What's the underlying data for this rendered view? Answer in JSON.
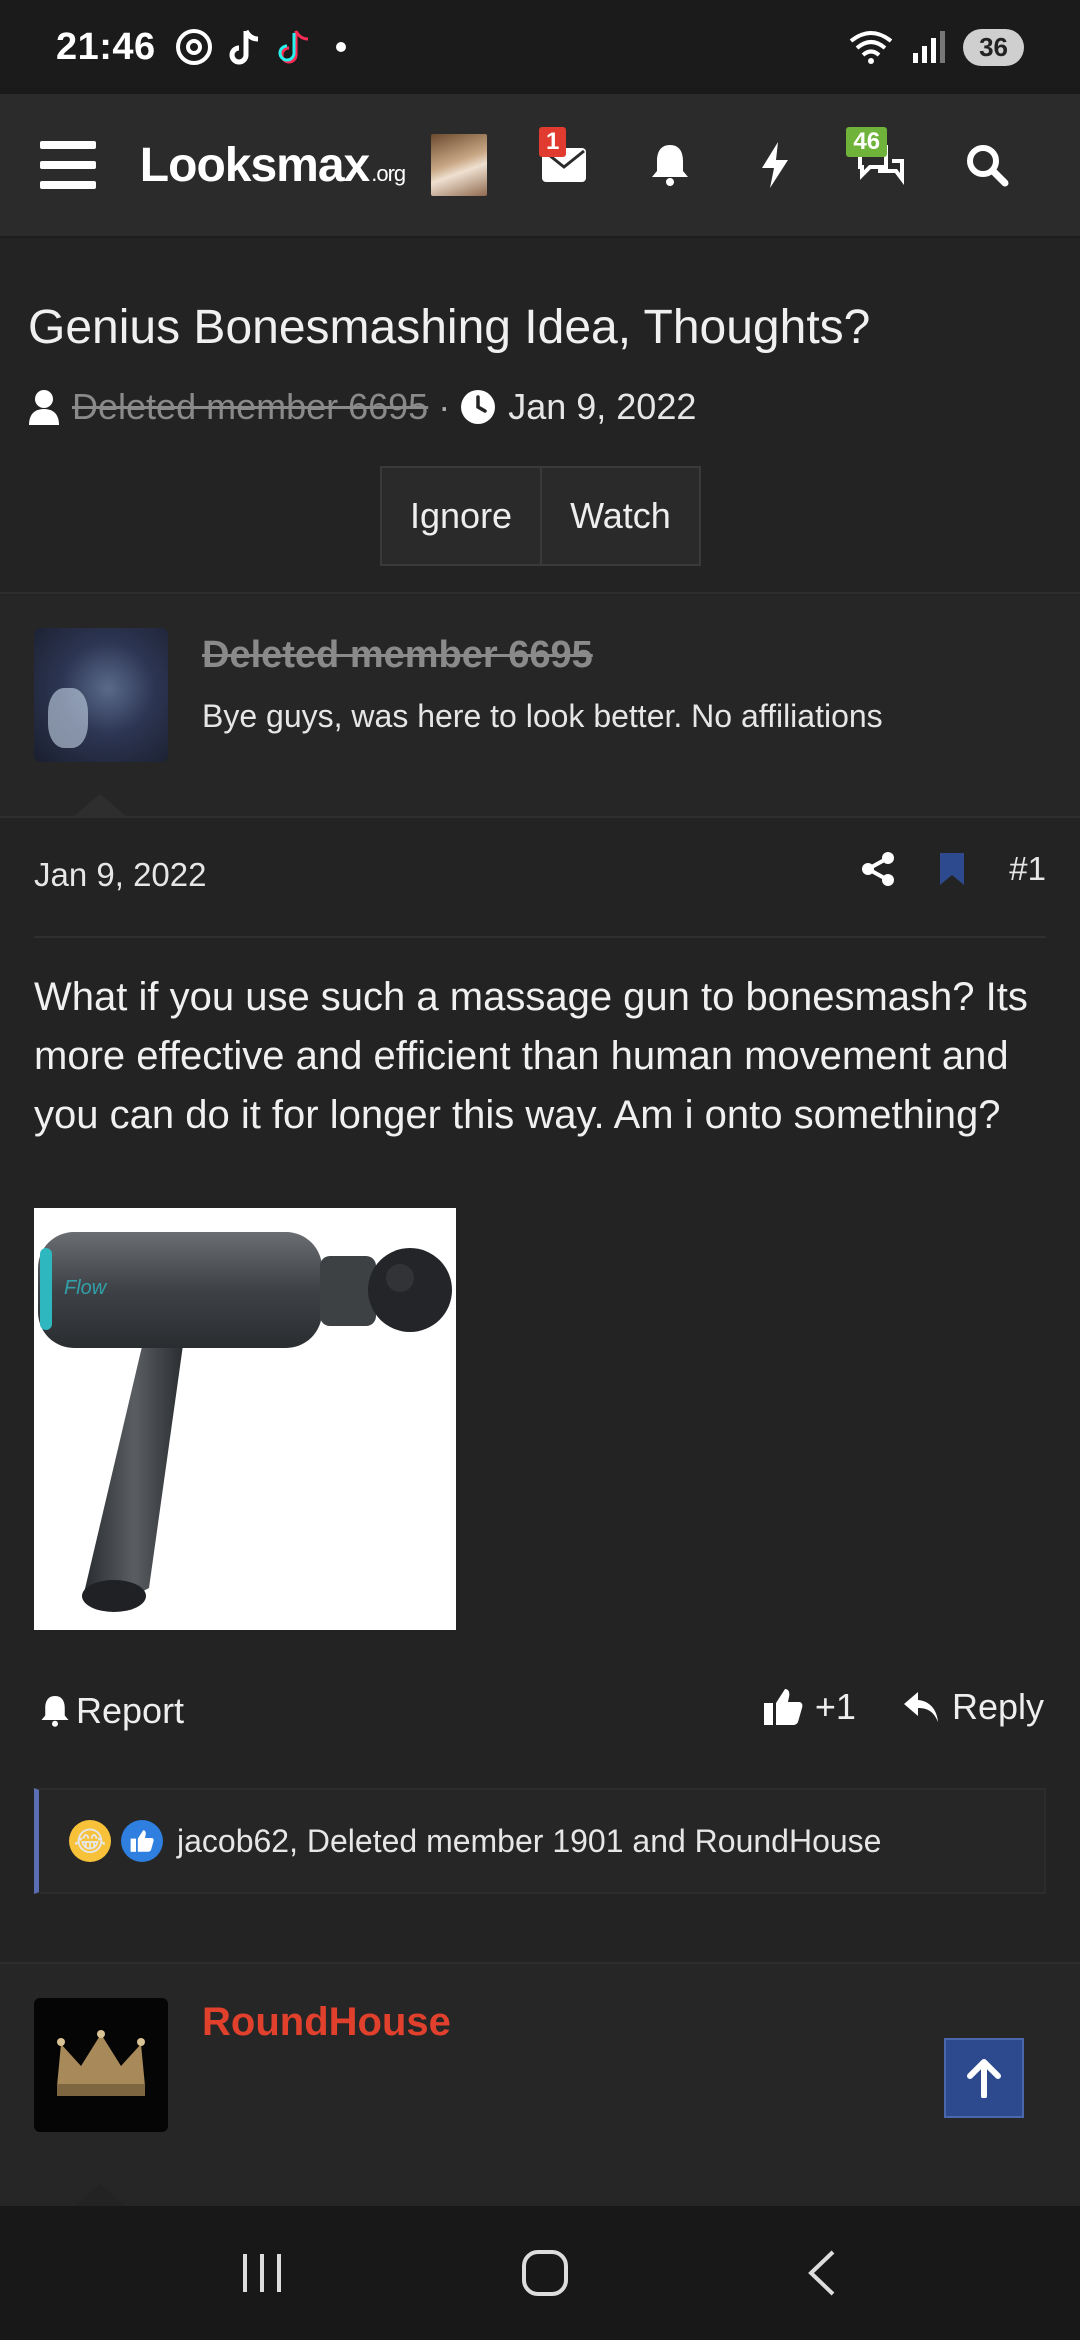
{
  "status_bar": {
    "time": "21:46",
    "notification_icons": [
      "threads-icon",
      "tiktok-icon",
      "tiktok-icon",
      "dot-icon"
    ],
    "battery": "36"
  },
  "navbar": {
    "logo_main": "Looksmax",
    "logo_suffix": ".org",
    "inbox_badge": "1",
    "alerts_badge": "46"
  },
  "thread": {
    "title": "Genius Bonesmashing Idea, Thoughts?",
    "author": "Deleted member 6695",
    "separator": "·",
    "date": "Jan 9, 2022",
    "ignore_label": "Ignore",
    "watch_label": "Watch"
  },
  "post1": {
    "author": "Deleted member 6695",
    "user_title": "Bye guys, was here to look better. No affiliations",
    "date": "Jan 9, 2022",
    "post_number": "#1",
    "body": "What if you use such a massage gun to bonesmash? Its more effective and efficient than human movement and you can do it for longer this way. Am i onto something?",
    "image_brand": "Flow",
    "report_label": "Report",
    "like_count": "+1",
    "reply_label": "Reply",
    "reactions_text": "jacob62, Deleted member 1901 and RoundHouse"
  },
  "post2": {
    "author": "RoundHouse"
  },
  "colors": {
    "accent_blue": "#2d4a8f",
    "username_red": "#e0402c",
    "badge_red": "#e03b2e",
    "badge_green": "#6fb33a"
  }
}
